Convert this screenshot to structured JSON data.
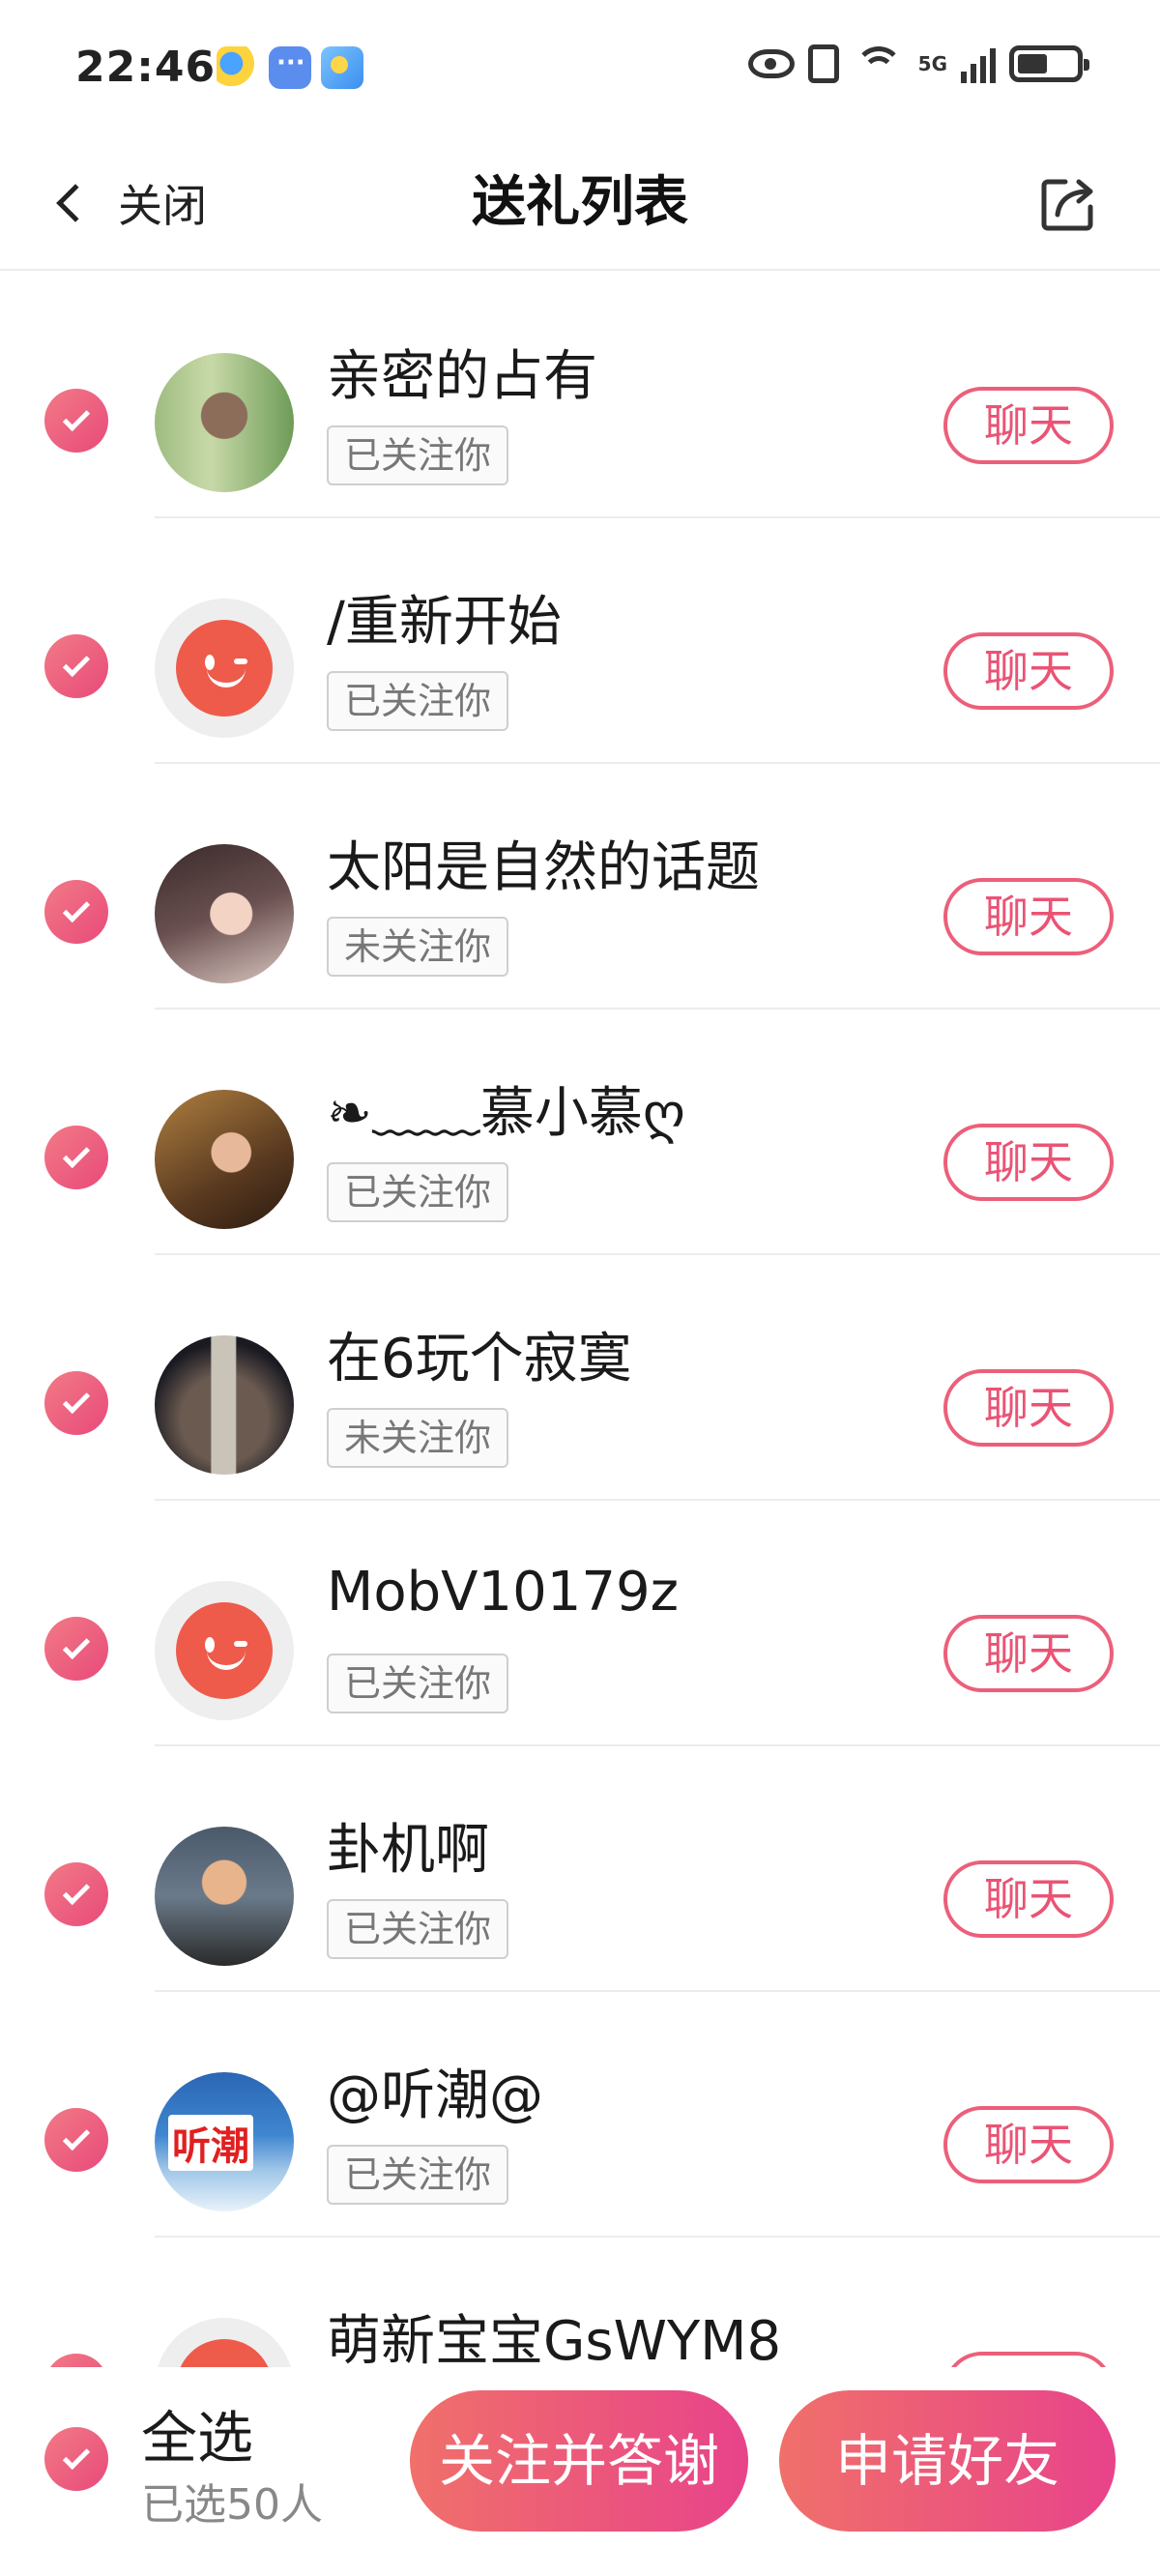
{
  "status_bar": {
    "time": "22:46",
    "network": "5G"
  },
  "nav": {
    "back_label": "关闭",
    "title": "送礼列表",
    "share_icon": "share-icon"
  },
  "list": {
    "chat_label": "聊天",
    "items": [
      {
        "name": "亲密的占有",
        "status": "已关注你",
        "avatar": "couple"
      },
      {
        "name": "/重新开始",
        "status": "已关注你",
        "avatar": "default"
      },
      {
        "name": "太阳是自然的话题",
        "status": "未关注你",
        "avatar": "girl"
      },
      {
        "name": "❧﹏﹏慕小慕ღ",
        "status": "已关注你",
        "avatar": "lady"
      },
      {
        "name": "在6玩个寂寞",
        "status": "未关注你",
        "avatar": "city"
      },
      {
        "name": "MobV10179z",
        "status": "已关注你",
        "avatar": "default"
      },
      {
        "name": "卦机啊",
        "status": "已关注你",
        "avatar": "baby"
      },
      {
        "name": "@听潮@",
        "status": "已关注你",
        "avatar": "tide",
        "avatar_text": "听潮"
      },
      {
        "name": "萌新宝宝GsWYM8",
        "status": "",
        "avatar": "default"
      }
    ]
  },
  "bottom": {
    "select_all_label": "全选",
    "selected_count": "已选50人",
    "follow_thank_label": "关注并答谢",
    "add_friend_label": "申请好友"
  },
  "colors": {
    "accent": "#e84a7a",
    "accent_start": "#f0706a",
    "divider": "#ececec"
  }
}
